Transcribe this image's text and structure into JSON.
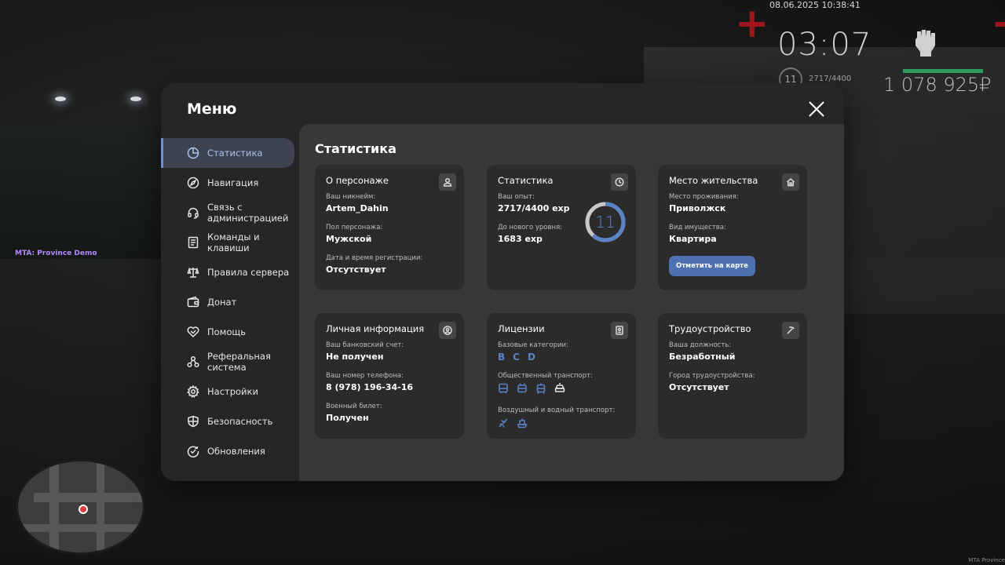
{
  "hud": {
    "datetime": "08.06.2025 10:38:41",
    "time": "03:07",
    "level": "11",
    "exp": "2717/4400",
    "money": "1 078 925₽",
    "mta_label": "MTA: Province Demo",
    "mta_corner": "MTA Province"
  },
  "menu": {
    "title": "Меню",
    "nav": [
      {
        "id": "stats",
        "label": "Статистика",
        "icon": "pie-chart-icon",
        "active": true
      },
      {
        "id": "navigation",
        "label": "Навигация",
        "icon": "compass-icon"
      },
      {
        "id": "contact-admin",
        "label": "Связь с администрацией",
        "icon": "headset-icon"
      },
      {
        "id": "commands",
        "label": "Команды и клавиши",
        "icon": "list-icon"
      },
      {
        "id": "rules",
        "label": "Правила сервера",
        "icon": "scales-icon"
      },
      {
        "id": "donate",
        "label": "Донат",
        "icon": "wallet-icon"
      },
      {
        "id": "help",
        "label": "Помощь",
        "icon": "handshake-icon"
      },
      {
        "id": "referral",
        "label": "Реферальная система",
        "icon": "network-icon"
      },
      {
        "id": "settings",
        "label": "Настройки",
        "icon": "gear-icon"
      },
      {
        "id": "security",
        "label": "Безопасность",
        "icon": "shield-icon"
      },
      {
        "id": "updates",
        "label": "Обновления",
        "icon": "check-circle-icon"
      }
    ]
  },
  "content": {
    "title": "Статистика",
    "character": {
      "title": "О персонаже",
      "nickname_label": "Ваш никнейм:",
      "nickname": "Artem_Dahin",
      "gender_label": "Пол персонажа:",
      "gender": "Мужской",
      "reg_label": "Дата и время регистрации:",
      "reg": "Отсутствует"
    },
    "stats": {
      "title": "Статистика",
      "exp_label": "Ваш опыт:",
      "exp": "2717/4400 exp",
      "next_label": "До нового уровня:",
      "next": "1683 exp",
      "level": "11",
      "progress": 0.6175
    },
    "residence": {
      "title": "Место жительства",
      "place_label": "Место проживания:",
      "place": "Приволжск",
      "property_label": "Вид имущества:",
      "property": "Квартира",
      "map_button": "Отметить на карте"
    },
    "personal": {
      "title": "Личная информация",
      "bank_label": "Ваш банковский счет:",
      "bank": "Не получен",
      "phone_label": "Ваш номер телефона:",
      "phone": "8 (978) 196-34-16",
      "military_label": "Военный билет:",
      "military": "Получен"
    },
    "licenses": {
      "title": "Лицензии",
      "base_label": "Базовые категории:",
      "base": [
        "B",
        "C",
        "D"
      ],
      "public_label": "Общественный транспорт:",
      "air_label": "Воздушный и водный транспорт:"
    },
    "employment": {
      "title": "Трудоустройство",
      "position_label": "Ваша должность:",
      "position": "Безработный",
      "city_label": "Город трудоустройства:",
      "city": "Отсутствует"
    }
  },
  "colors": {
    "accent": "#5a82c4",
    "active_bg": "#3d4350",
    "panel": "#262626",
    "content": "#383838",
    "card": "#2b2b2b",
    "health": "#2a9c5c"
  }
}
